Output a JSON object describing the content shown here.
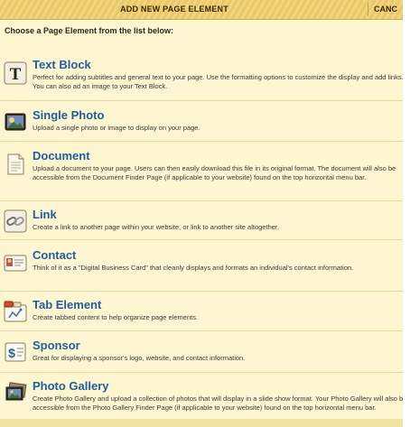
{
  "dialog": {
    "title": "ADD NEW PAGE ELEMENT",
    "cancel_label": "CANC",
    "instructions": "Choose a Page Element from the list below:"
  },
  "items": [
    {
      "title": "Text Block",
      "description": "Perfect for adding subtitles and general text to your page. Use the formatting options to customize the display and add links. You can also ad an image to your Text Block.",
      "icon": "text-block-icon"
    },
    {
      "title": "Single Photo",
      "description": "Upload a single photo or image to display on your page.",
      "icon": "photo-icon"
    },
    {
      "title": "Document",
      "description": "Upload a document to your page. Users can then easily download this file in its original format. The document will also be accessible from the Document Finder Page (if applicable to your website) found on the top horizontal menu bar.",
      "icon": "document-icon"
    },
    {
      "title": "Link",
      "description": "Create a link to another page within your website, or link to another site altogether.",
      "icon": "link-icon"
    },
    {
      "title": "Contact",
      "description": "Think of it as a \"Digital Business Card\" that cleanly displays and formats an individual's contact information.",
      "icon": "contact-card-icon"
    },
    {
      "title": "Tab Element",
      "description": "Create tabbed content to help organize page elements.",
      "icon": "tab-element-icon"
    },
    {
      "title": "Sponsor",
      "description": "Great for displaying a sponsor's logo, website, and contact information.",
      "icon": "sponsor-icon"
    },
    {
      "title": "Photo Gallery",
      "description": "Create Photo Gallery and upload a collection of photos that will display in a slide show format. Your Photo Gallery will also be accessible from the Photo Gallery Finder Page (if applicable to your website) found on the top horizontal menu bar.",
      "icon": "photo-gallery-icon"
    }
  ]
}
